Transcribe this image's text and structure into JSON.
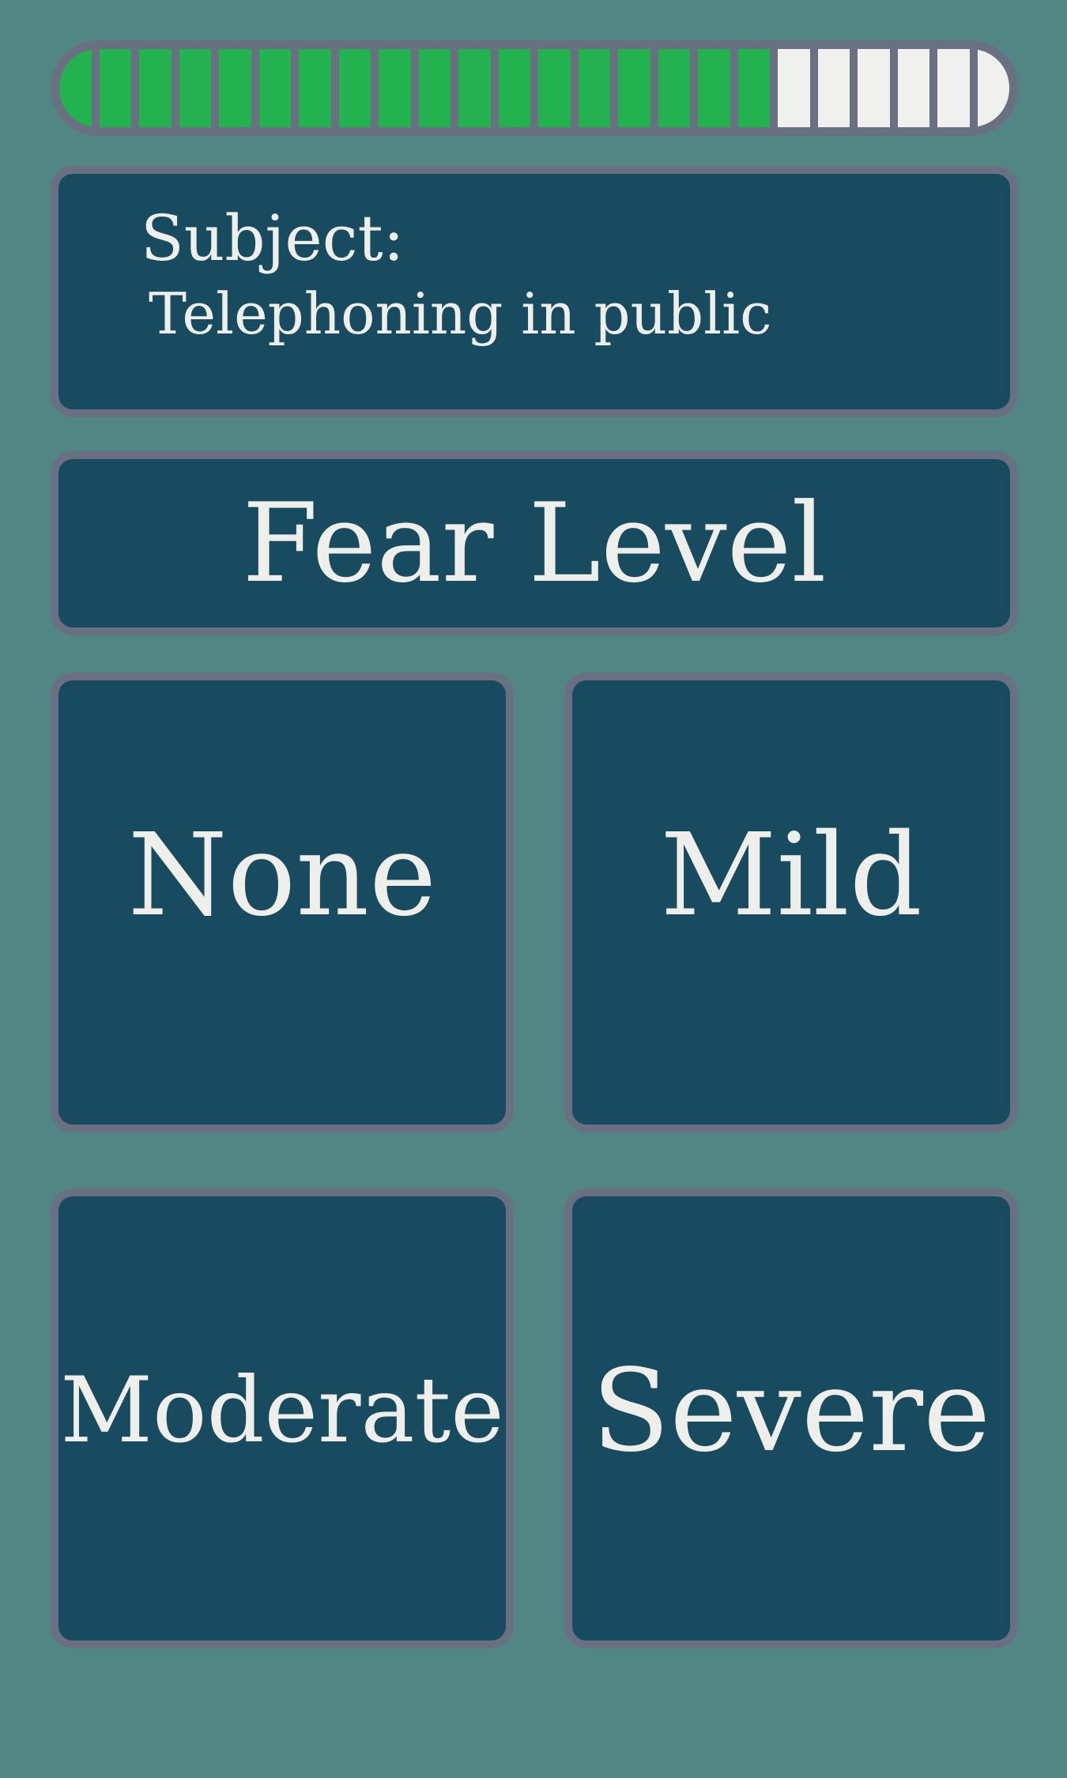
{
  "progress": {
    "completed_segments": 18,
    "total_segments": 24,
    "on_color": "#24b250",
    "off_color": "#f0f1ee"
  },
  "subject": {
    "label": "Subject:",
    "value": "Telephoning in public"
  },
  "question": {
    "title": "Fear Level"
  },
  "options": [
    {
      "label": "None"
    },
    {
      "label": "Mild"
    },
    {
      "label": "Moderate"
    },
    {
      "label": "Severe"
    }
  ],
  "colors": {
    "background": "#528684",
    "panel": "#194b60",
    "border": "#697081",
    "text": "#eeefeb"
  }
}
